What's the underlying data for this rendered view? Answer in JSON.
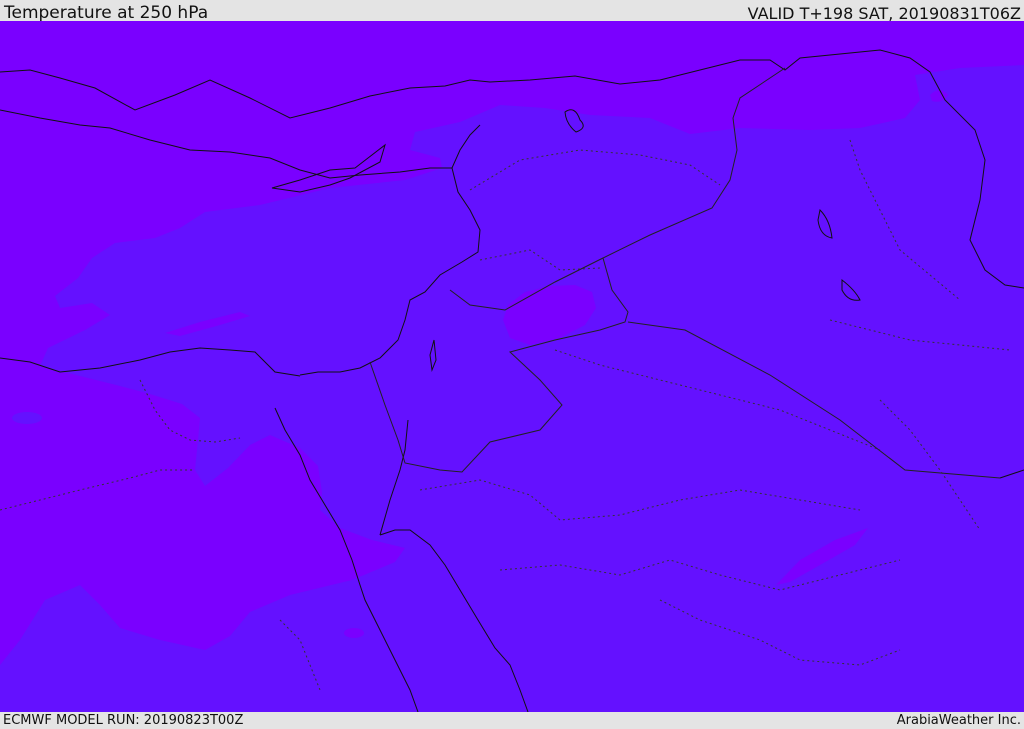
{
  "header": {
    "title": "Temperature at 250 hPa",
    "valid": "VALID T+198 SAT, 20190831T06Z"
  },
  "footer": {
    "model_run": "ECMWF MODEL RUN: 20190823T00Z",
    "credit": "ArabiaWeather Inc."
  },
  "map": {
    "colors": {
      "warm_band": "#7a00ff",
      "cool_band": "#6411ff",
      "coastline": "#111111",
      "border": "#222222"
    }
  }
}
